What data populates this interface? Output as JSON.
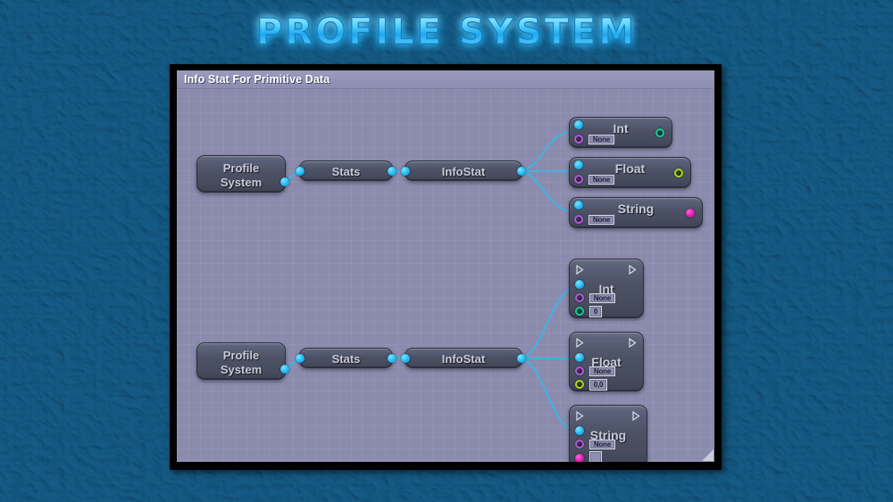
{
  "page": {
    "title": "PROFILE SYSTEM",
    "background_color": "#10486f",
    "title_color": "#3fc6ff"
  },
  "panel": {
    "header_title": "Info Stat For Primitive Data",
    "canvas_color": "#8b8bae",
    "header_color": "#9a9abd",
    "border_color": "#000000"
  },
  "graph": {
    "wire_color": "#2bbdf0",
    "node_color": "#4c5165",
    "pin_colors": {
      "exec": "#ffffff",
      "cyan": "#1eb8f5",
      "purple": "#b05ad8",
      "teal": "#19c79b",
      "lime": "#a8d91a",
      "magenta": "#e21ab0"
    },
    "rows": [
      {
        "name": "row-primitive-getters",
        "chain": [
          {
            "label": "Profile\nSystem",
            "type": "object-node"
          },
          {
            "label": "Stats",
            "type": "pin-node"
          },
          {
            "label": "InfoStat",
            "type": "pin-node"
          }
        ],
        "outputs": [
          {
            "label": "Int",
            "dropdown": "None",
            "out_pin": "teal"
          },
          {
            "label": "Float",
            "dropdown": "None",
            "out_pin": "lime"
          },
          {
            "label": "String",
            "dropdown": "None",
            "out_pin": "magenta"
          }
        ]
      },
      {
        "name": "row-primitive-setters",
        "chain": [
          {
            "label": "Profile\nSystem",
            "type": "object-node"
          },
          {
            "label": "Stats",
            "type": "pin-node"
          },
          {
            "label": "InfoStat",
            "type": "pin-node"
          }
        ],
        "outputs": [
          {
            "label": "Int",
            "dropdown": "None",
            "value": "0",
            "value_pin": "teal"
          },
          {
            "label": "Float",
            "dropdown": "None",
            "value": "0,0",
            "value_pin": "lime"
          },
          {
            "label": "String",
            "dropdown": "None",
            "value": "",
            "value_pin": "magenta"
          }
        ]
      }
    ]
  }
}
